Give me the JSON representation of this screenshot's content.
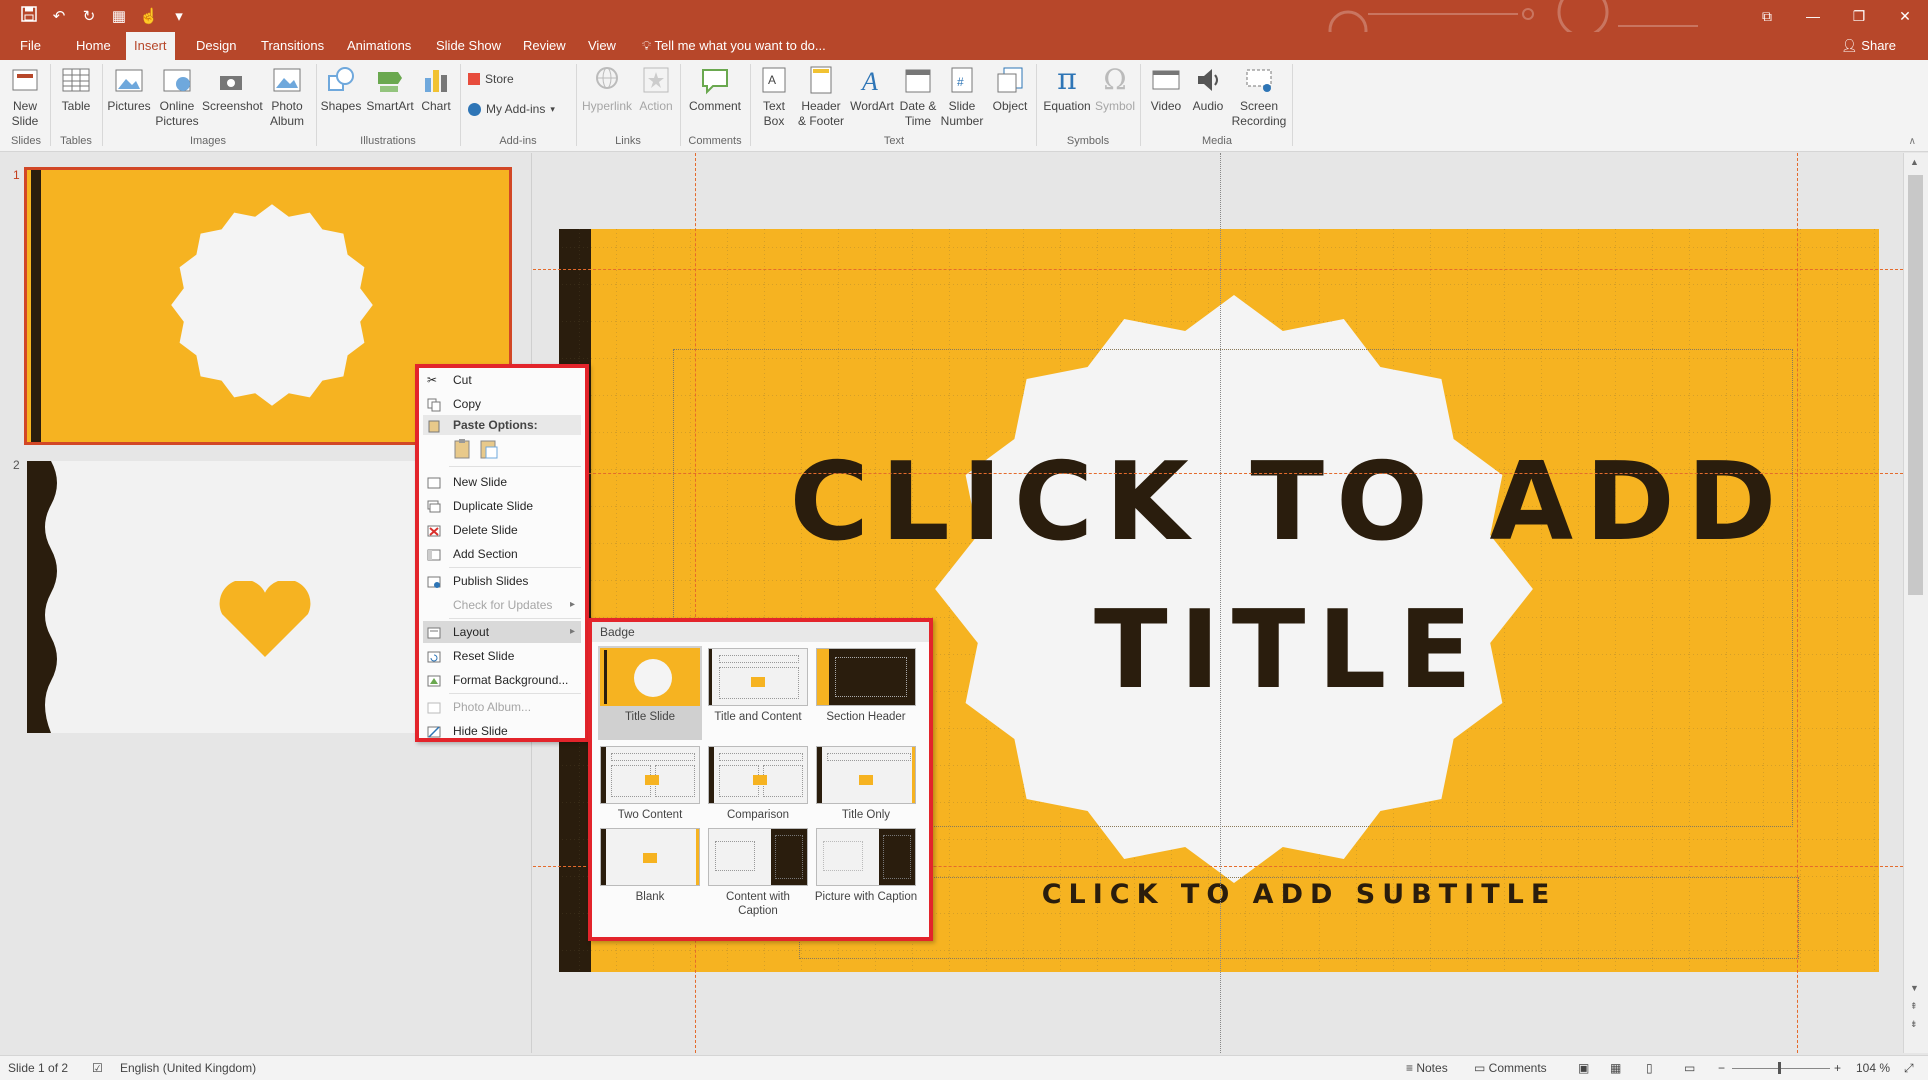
{
  "qat": {
    "icons": [
      "save-icon",
      "undo-icon",
      "redo-icon",
      "present-icon",
      "touch-mode-icon",
      "customize-icon"
    ]
  },
  "ribbon_tabs": [
    "File",
    "Home",
    "Insert",
    "Design",
    "Transitions",
    "Animations",
    "Slide Show",
    "Review",
    "View"
  ],
  "active_tab": "Insert",
  "tell_me": "Tell me what you want to do...",
  "share": "Share",
  "ribbon": {
    "new_slide": "New Slide",
    "table": "Table",
    "pictures": "Pictures",
    "online_pictures": "Online Pictures",
    "screenshot": "Screenshot",
    "photo_album": "Photo Album",
    "shapes": "Shapes",
    "smartart": "SmartArt",
    "chart": "Chart",
    "store": "Store",
    "my_addins": "My Add-ins",
    "hyperlink": "Hyperlink",
    "action": "Action",
    "comment": "Comment",
    "text_box": "Text Box",
    "header_footer": "Header & Footer",
    "wordart": "WordArt",
    "date_time": "Date & Time",
    "slide_number": "Slide Number",
    "object": "Object",
    "equation": "Equation",
    "symbol": "Symbol",
    "video": "Video",
    "audio": "Audio",
    "screen_recording": "Screen Recording",
    "groups": {
      "slides": "Slides",
      "tables": "Tables",
      "images": "Images",
      "illustrations": "Illustrations",
      "addins": "Add-ins",
      "links": "Links",
      "comments": "Comments",
      "text": "Text",
      "symbols": "Symbols",
      "media": "Media"
    }
  },
  "slides": {
    "numbers": [
      "1",
      "2"
    ]
  },
  "slide": {
    "title": "CLICK TO ADD TITLE",
    "subtitle": "CLICK TO ADD SUBTITLE"
  },
  "context_menu": {
    "cut": "Cut",
    "copy": "Copy",
    "paste_options": "Paste Options:",
    "new_slide": "New Slide",
    "duplicate_slide": "Duplicate Slide",
    "delete_slide": "Delete Slide",
    "add_section": "Add Section",
    "publish_slides": "Publish Slides",
    "check_updates": "Check for Updates",
    "layout": "Layout",
    "reset_slide": "Reset Slide",
    "format_background": "Format Background...",
    "photo_album": "Photo Album...",
    "hide_slide": "Hide Slide"
  },
  "layout_menu": {
    "theme": "Badge",
    "items": [
      {
        "label": "Title Slide"
      },
      {
        "label": "Title and Content"
      },
      {
        "label": "Section Header"
      },
      {
        "label": "Two Content"
      },
      {
        "label": "Comparison"
      },
      {
        "label": "Title Only"
      },
      {
        "label": "Blank"
      },
      {
        "label": "Content with Caption"
      },
      {
        "label": "Picture with Caption"
      }
    ],
    "selected_index": 0
  },
  "status": {
    "slide_info": "Slide 1 of 2",
    "language": "English (United Kingdom)",
    "notes": "Notes",
    "comments": "Comments",
    "zoom": "104 %"
  },
  "colors": {
    "accent": "#b7472a",
    "slide_bg": "#f6b321",
    "dark": "#2a1d0d",
    "highlight_border": "#e3242b"
  }
}
